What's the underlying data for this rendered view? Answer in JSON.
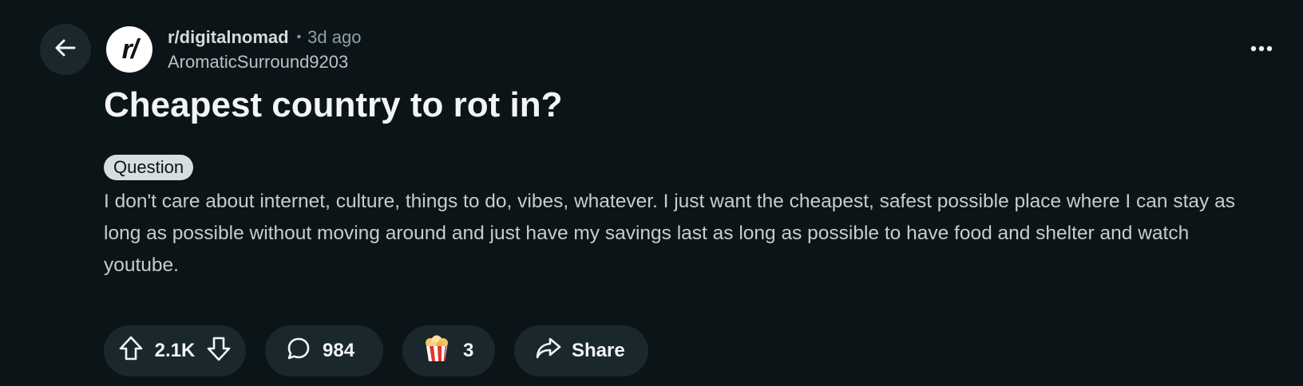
{
  "header": {
    "back_icon": "arrow-left-icon",
    "subreddit_icon_text": "r/",
    "subreddit": "r/digitalnomad",
    "separator": "•",
    "time_ago": "3d ago",
    "author": "AromaticSurround9203",
    "more_icon": "ellipsis-icon"
  },
  "post": {
    "title": "Cheapest country to rot in?",
    "flair": "Question",
    "body": "I don't care about internet, culture, things to do, vibes, whatever. I just want the cheapest, safest possible place where I can stay as long as possible without moving around and just have my savings last as long as possible to have food and shelter and watch youtube."
  },
  "actions": {
    "upvote_icon": "arrow-up-icon",
    "score": "2.1K",
    "downvote_icon": "arrow-down-icon",
    "comment_icon": "speech-bubble-icon",
    "comments": "984",
    "award_icon": "popcorn-icon",
    "awards": "3",
    "share_icon": "share-arrow-icon",
    "share_label": "Share"
  },
  "colors": {
    "background": "#0b1416",
    "pill_background": "#1a282d",
    "flair_background": "#d8dde0",
    "text_primary": "#f2f4f5",
    "text_secondary": "#8ba2ad"
  }
}
